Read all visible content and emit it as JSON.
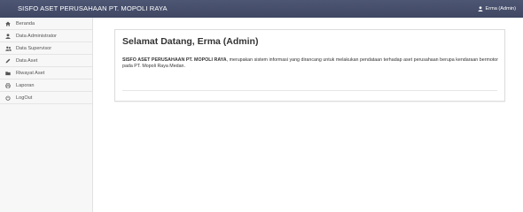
{
  "header": {
    "brand": "SISFO ASET PERUSAHAAN PT. MOPOLI RAYA",
    "user_label": "Erma (Admin)"
  },
  "sidebar": {
    "items": [
      {
        "label": "Beranda",
        "icon": "home-icon"
      },
      {
        "label": "Data Administrator",
        "icon": "user-icon"
      },
      {
        "label": "Data Supervisor",
        "icon": "users-icon"
      },
      {
        "label": "Data Aset",
        "icon": "pencil-icon"
      },
      {
        "label": "Riwayat Aset",
        "icon": "folder-icon"
      },
      {
        "label": "Laporan",
        "icon": "print-icon"
      },
      {
        "label": "LogOut",
        "icon": "power-icon"
      }
    ]
  },
  "main": {
    "title": "Selamat Datang, Erma (Admin)",
    "desc_strong": "SISFO ASET PERUSAHAAN PT. MOPOLI RAYA",
    "desc_text": ", merupakan sistem informasi yang dirancang untuk melakukan pendataan terhadap aset perusahaan berupa kendaraan bermotor pada PT. Mopoli Raya Medan."
  },
  "colors": {
    "topbar": "#4a5270",
    "sidebar_bg": "#f7f7f7",
    "text": "#333333"
  }
}
